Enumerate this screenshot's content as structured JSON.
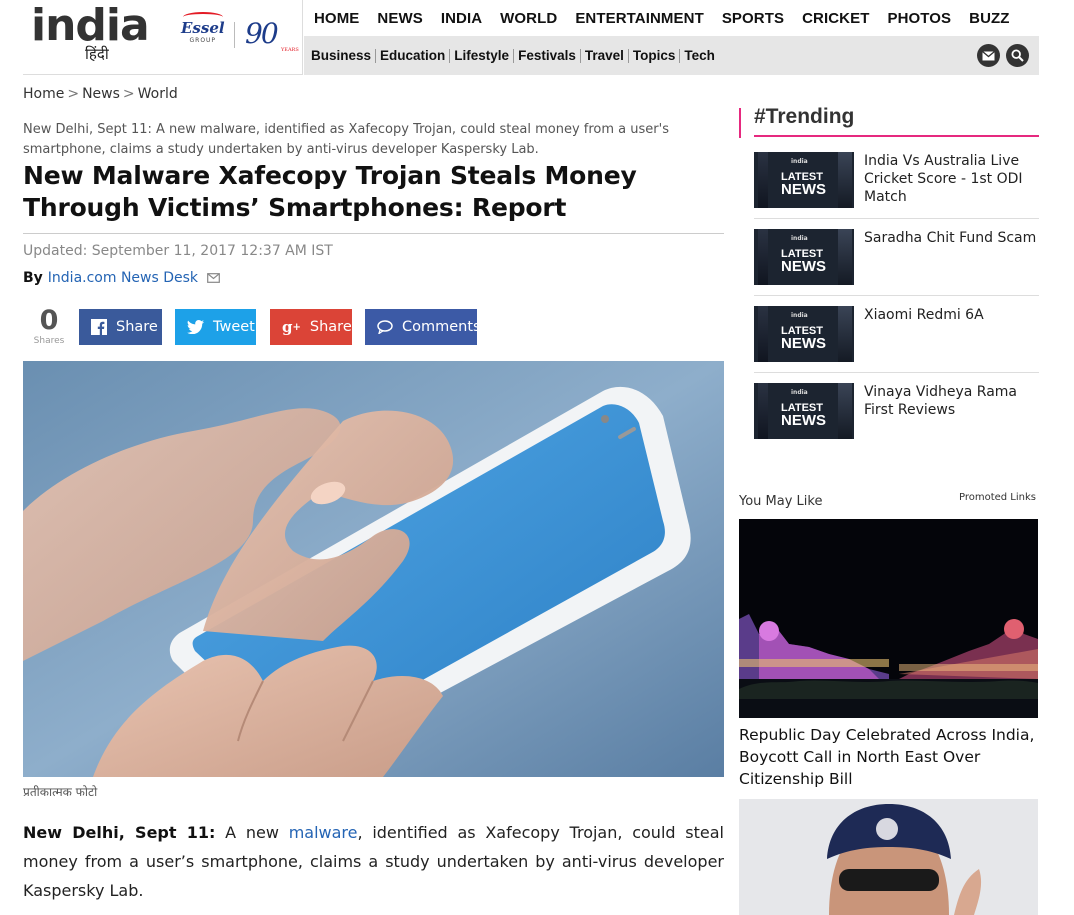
{
  "brand": {
    "logo_text": "india",
    "logo_sub": "हिंदी",
    "partner_name": "Essel",
    "partner_group": "GROUP",
    "anniversary": "90",
    "anniversary_label": "YEARS"
  },
  "nav": {
    "main": [
      "HOME",
      "NEWS",
      "INDIA",
      "WORLD",
      "ENTERTAINMENT",
      "SPORTS",
      "CRICKET",
      "PHOTOS",
      "BUZZ"
    ],
    "sub": [
      "Business",
      "Education",
      "Lifestyle",
      "Festivals",
      "Travel",
      "Topics",
      "Tech"
    ],
    "mail_icon": "mail-icon",
    "search_icon": "search-icon"
  },
  "breadcrumb": [
    "Home",
    "News",
    "World"
  ],
  "article": {
    "summary": "New Delhi, Sept 11: A new malware, identified as Xafecopy Trojan, could steal money from a user's smartphone, claims a study undertaken by anti-virus developer Kaspersky Lab.",
    "headline": "New Malware Xafecopy Trojan Steals Money Through Victims’ Smartphones: Report",
    "updated": "Updated: September 11, 2017 12:37 AM IST",
    "by_label": "By",
    "author": "India.com News Desk",
    "shares_count": "0",
    "shares_label": "Shares",
    "buttons": {
      "facebook": "Share",
      "twitter": "Tweet",
      "gplus": "Share",
      "comments": "Comments"
    },
    "image_caption": "प्रतीकात्मक फोटो",
    "body_lead": "New Delhi, Sept 11:",
    "body_pre": " A new ",
    "body_link": "malware",
    "body_post": ", identified as Xafecopy Trojan, could steal money from a user’s smartphone, claims a study undertaken by anti-virus developer Kaspersky Lab."
  },
  "sidebar": {
    "trending_title": "#Trending",
    "thumb_logo": "india",
    "thumb_latest": "LATEST",
    "thumb_news": "NEWS",
    "trending": [
      {
        "title": "India Vs Australia Live Cricket Score - 1st ODI Match"
      },
      {
        "title": "Saradha Chit Fund Scam"
      },
      {
        "title": "Xiaomi Redmi 6A"
      },
      {
        "title": "Vinaya Vidheya Rama First Reviews"
      }
    ],
    "you_may_like": "You May Like",
    "promoted": "Promoted Links",
    "ad_title": "Republic Day Celebrated Across India, Boycott Call in North East Over Citizenship Bill"
  },
  "colors": {
    "accent_pink": "#e6297f",
    "facebook": "#3a5a9b",
    "twitter": "#1da1e8",
    "gplus": "#db4437",
    "comments": "#3c5aa6",
    "link": "#2464b4"
  }
}
